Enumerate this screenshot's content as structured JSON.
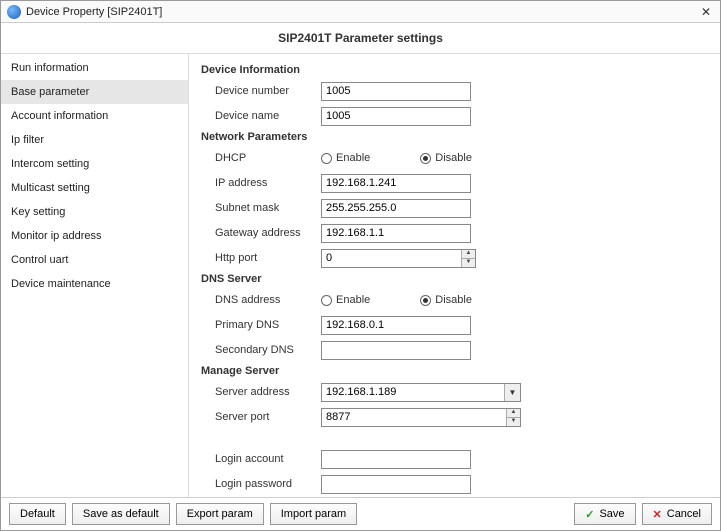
{
  "window": {
    "title": "Device Property [SIP2401T]",
    "subtitle": "SIP2401T Parameter settings"
  },
  "sidebar": {
    "items": [
      {
        "label": "Run information"
      },
      {
        "label": "Base parameter"
      },
      {
        "label": "Account information"
      },
      {
        "label": "Ip filter"
      },
      {
        "label": "Intercom setting"
      },
      {
        "label": "Multicast setting"
      },
      {
        "label": "Key setting"
      },
      {
        "label": "Monitor ip address"
      },
      {
        "label": "Control uart"
      },
      {
        "label": "Device maintenance"
      }
    ],
    "active_index": 1
  },
  "sections": {
    "device_info": {
      "header": "Device Information",
      "device_number": {
        "label": "Device number",
        "value": "1005"
      },
      "device_name": {
        "label": "Device name",
        "value": "1005"
      }
    },
    "network": {
      "header": "Network Parameters",
      "dhcp": {
        "label": "DHCP",
        "enable_label": "Enable",
        "disable_label": "Disable",
        "value": "Disable"
      },
      "ip_address": {
        "label": "IP address",
        "value": "192.168.1.241"
      },
      "subnet_mask": {
        "label": "Subnet mask",
        "value": "255.255.255.0"
      },
      "gateway_address": {
        "label": "Gateway address",
        "value": "192.168.1.1"
      },
      "http_port": {
        "label": "Http port",
        "value": "0"
      }
    },
    "dns": {
      "header": "DNS Server",
      "dns_address": {
        "label": "DNS address",
        "enable_label": "Enable",
        "disable_label": "Disable",
        "value": "Disable"
      },
      "primary_dns": {
        "label": "Primary DNS",
        "value": "192.168.0.1"
      },
      "secondary_dns": {
        "label": "Secondary DNS",
        "value": ""
      }
    },
    "manage": {
      "header": "Manage Server",
      "server_address": {
        "label": "Server address",
        "value": "192.168.1.189"
      },
      "server_port": {
        "label": "Server port",
        "value": "8877"
      },
      "login_account": {
        "label": "Login account",
        "value": ""
      },
      "login_password": {
        "label": "Login password",
        "value": ""
      }
    }
  },
  "footer": {
    "default": "Default",
    "save_as_default": "Save as default",
    "export_param": "Export param",
    "import_param": "Import param",
    "save": "Save",
    "cancel": "Cancel"
  }
}
